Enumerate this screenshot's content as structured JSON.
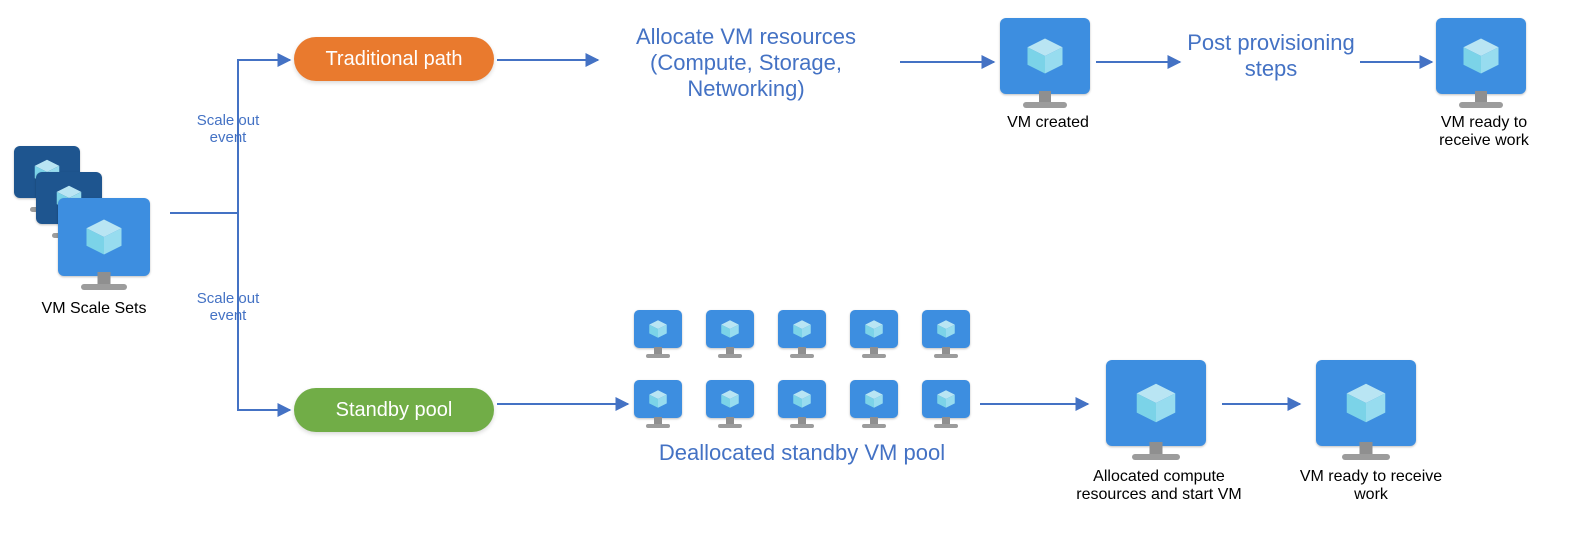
{
  "colors": {
    "accent": "#4472c4",
    "orange": "#e97a2e",
    "green": "#71ad47"
  },
  "source": {
    "label": "VM Scale Sets"
  },
  "top": {
    "event": "Scale out event",
    "path_label": "Traditional path",
    "allocate": "Allocate VM resources (Compute, Storage, Networking)",
    "created": "VM created",
    "post": "Post provisioning steps",
    "ready": "VM ready to receive work"
  },
  "bottom": {
    "event": "Scale out event",
    "path_label": "Standby pool",
    "pool": "Deallocated standby VM pool",
    "allocated": "Allocated compute resources and start VM",
    "ready": "VM ready to receive work"
  }
}
